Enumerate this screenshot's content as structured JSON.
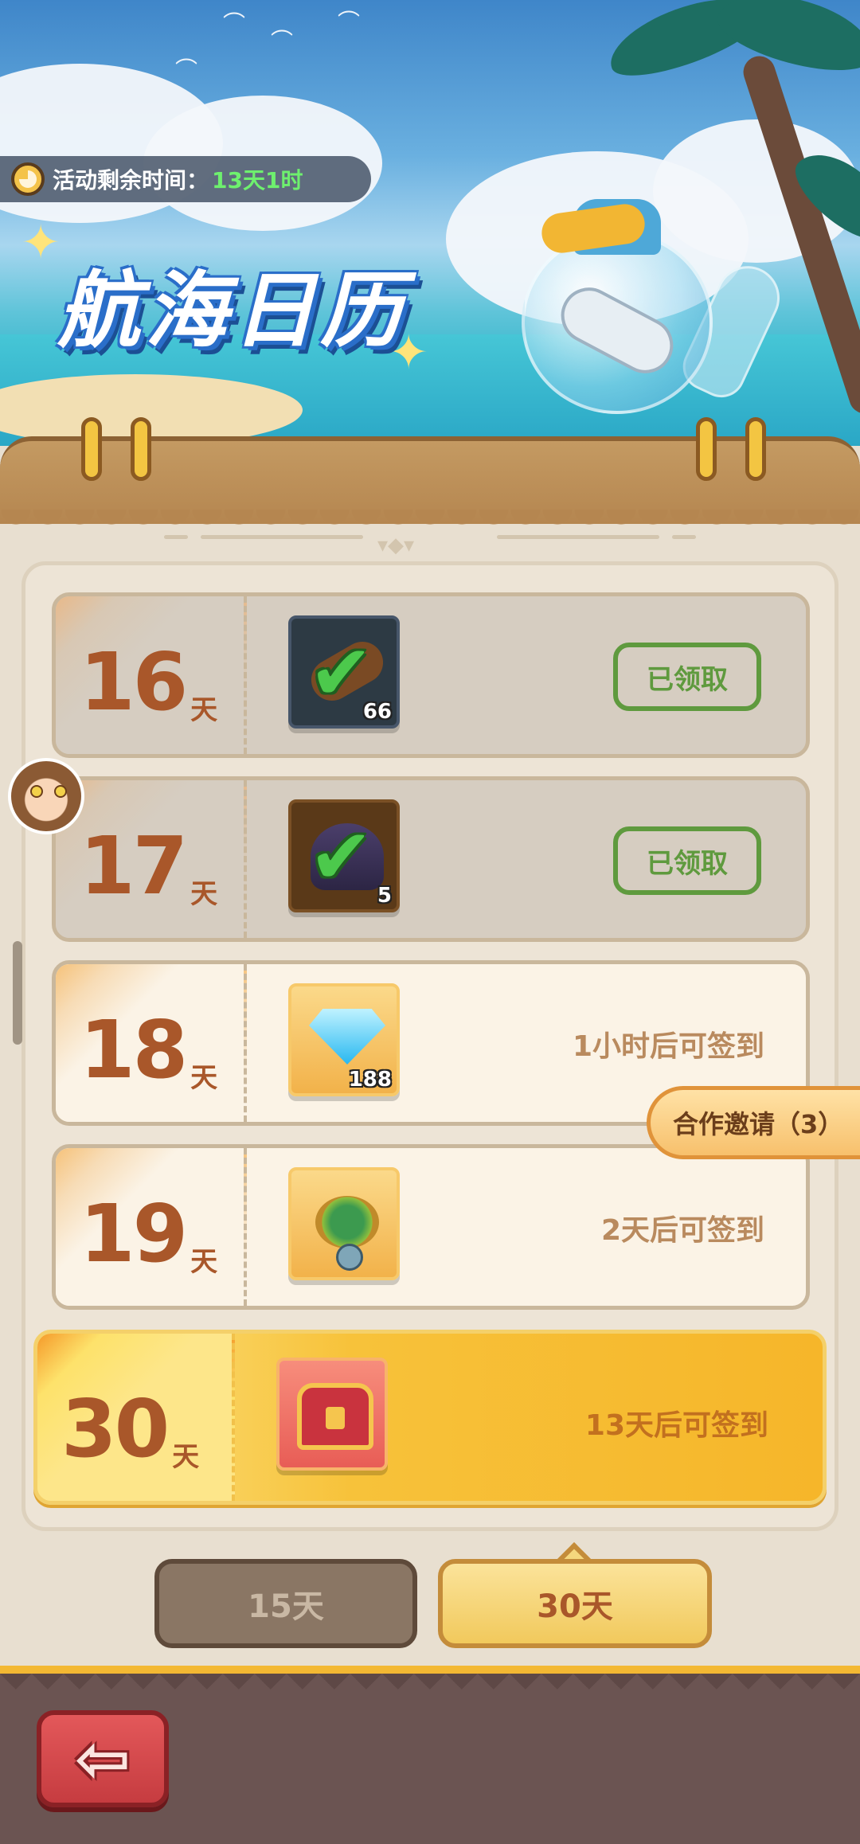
{
  "banner": {
    "timer_label": "活动剩余时间：",
    "timer_value": "13天1时",
    "title": "航海日历"
  },
  "rows": [
    {
      "day": "16",
      "unit": "天",
      "reward_icon": "log-icon",
      "quantity": "66",
      "state": "claimed",
      "button_label": "已领取"
    },
    {
      "day": "17",
      "unit": "天",
      "reward_icon": "shell-icon",
      "quantity": "5",
      "state": "claimed",
      "button_label": "已领取"
    },
    {
      "day": "18",
      "unit": "天",
      "reward_icon": "diamond-icon",
      "quantity": "188",
      "state": "pending",
      "status": "1小时后可签到"
    },
    {
      "day": "19",
      "unit": "天",
      "reward_icon": "compass-icon",
      "state": "pending",
      "status": "2天后可签到"
    },
    {
      "day": "30",
      "unit": "天",
      "reward_icon": "treasure-chest-icon",
      "state": "final",
      "status": "13天后可签到"
    }
  ],
  "invite_label": "合作邀请（3）",
  "tabs": [
    {
      "label": "15天",
      "active": false
    },
    {
      "label": "30天",
      "active": true
    }
  ],
  "footer": {
    "back_icon": "back-arrow-icon"
  },
  "colors": {
    "accent": "#f3b833",
    "day_text": "#a9572a",
    "claimed_green": "#5f9a3e",
    "timer_green": "#6ef06e"
  }
}
